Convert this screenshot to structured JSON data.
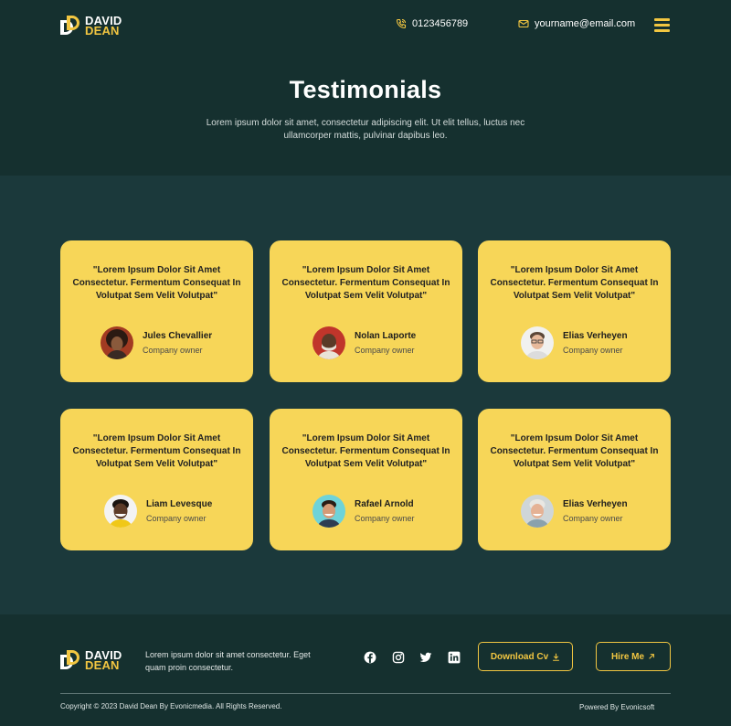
{
  "brand": {
    "line1": "DAVID",
    "line2": "DEAN"
  },
  "header": {
    "phone": "0123456789",
    "email": "yourname@email.com",
    "menu_icon": "hamburger-menu-icon"
  },
  "hero": {
    "title": "Testimonials",
    "subtitle": "Lorem ipsum dolor sit amet, consectetur adipiscing elit. Ut elit tellus, luctus nec ullamcorper mattis, pulvinar dapibus leo."
  },
  "testimonials": [
    {
      "quote": "\"Lorem Ipsum Dolor Sit Amet Consectetur. Fermentum Consequat In Volutpat Sem Velit Volutpat\"",
      "name": "Jules Chevallier",
      "role": "Company owner"
    },
    {
      "quote": "\"Lorem Ipsum Dolor Sit Amet Consectetur. Fermentum Consequat In Volutpat Sem Velit Volutpat\"",
      "name": "Nolan Laporte",
      "role": "Company owner"
    },
    {
      "quote": "\"Lorem Ipsum Dolor Sit Amet Consectetur. Fermentum Consequat In Volutpat Sem Velit Volutpat\"",
      "name": "Elias Verheyen",
      "role": "Company owner"
    },
    {
      "quote": "\"Lorem Ipsum Dolor Sit Amet Consectetur. Fermentum Consequat In Volutpat Sem Velit Volutpat\"",
      "name": "Liam Levesque",
      "role": "Company owner"
    },
    {
      "quote": "\"Lorem Ipsum Dolor Sit Amet Consectetur. Fermentum Consequat In Volutpat Sem Velit Volutpat\"",
      "name": "Rafael Arnold",
      "role": "Company owner"
    },
    {
      "quote": "\"Lorem Ipsum Dolor Sit Amet Consectetur. Fermentum Consequat In Volutpat Sem Velit Volutpat\"",
      "name": "Elias Verheyen",
      "role": "Company owner"
    }
  ],
  "footer": {
    "text": "Lorem ipsum dolor sit amet consectetur. Eget quam proin consectetur.",
    "social": [
      "facebook-icon",
      "instagram-icon",
      "twitter-icon",
      "linkedin-icon"
    ],
    "download_label": "Download Cv",
    "hire_label": "Hire Me",
    "copyright": "Copyright © 2023 David Dean By Evonicmedia. All Rights Reserved.",
    "powered": "Powered By Evonicsoft"
  },
  "colors": {
    "accent": "#f2c641",
    "card": "#f7d658",
    "header_bg": "#15302f",
    "section_bg": "#1b393b"
  }
}
